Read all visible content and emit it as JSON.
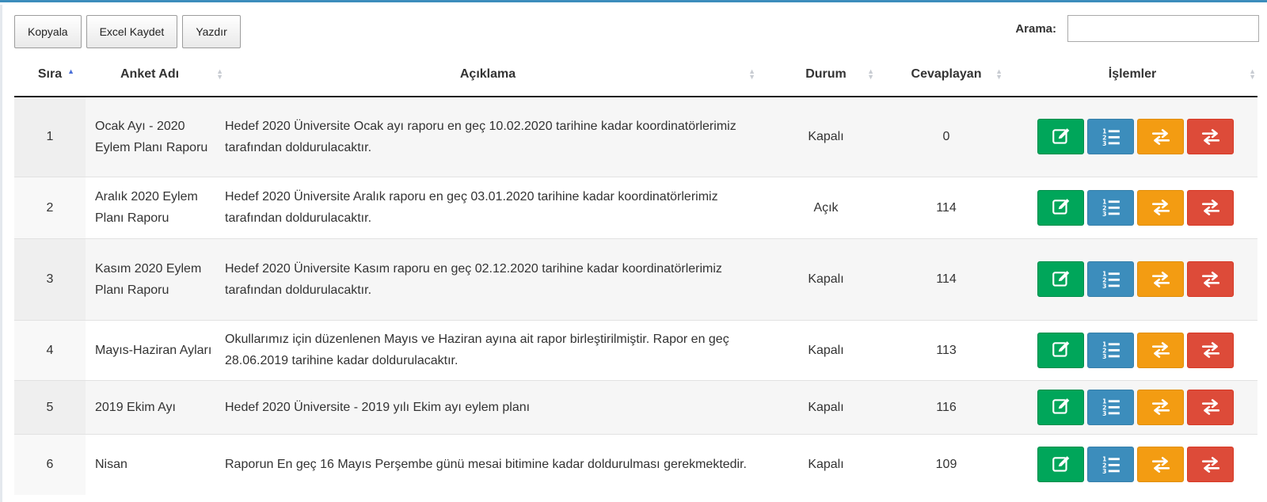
{
  "toolbar": {
    "copy_label": "Kopyala",
    "excel_label": "Excel Kaydet",
    "print_label": "Yazdır"
  },
  "search": {
    "label": "Arama:",
    "value": ""
  },
  "table": {
    "headers": {
      "no": "Sıra",
      "name": "Anket Adı",
      "description": "Açıklama",
      "status": "Durum",
      "respondents": "Cevaplayan",
      "actions": "İşlemler"
    },
    "sorted_column": "no",
    "sort_direction": "asc",
    "rows": [
      {
        "no": "1",
        "name": "Ocak Ayı - 2020 Eylem Planı Raporu",
        "description": "Hedef 2020 Üniversite Ocak ayı raporu en geç 10.02.2020 tarihine kadar koordinatörlerimiz tarafından doldurulacaktır.",
        "status": "Kapalı",
        "respondents": "0"
      },
      {
        "no": "2",
        "name": "Aralık 2020 Eylem Planı Raporu",
        "description": "Hedef 2020 Üniversite Aralık raporu en geç 03.01.2020 tarihine kadar koordinatörlerimiz tarafından doldurulacaktır.",
        "status": "Açık",
        "respondents": "114"
      },
      {
        "no": "3",
        "name": "Kasım 2020 Eylem Planı Raporu",
        "description": "Hedef 2020 Üniversite Kasım raporu en geç 02.12.2020 tarihine kadar koordinatörlerimiz tarafından doldurulacaktır.",
        "status": "Kapalı",
        "respondents": "114"
      },
      {
        "no": "4",
        "name": "Mayıs-Haziran Ayları",
        "description": "Okullarımız için düzenlenen Mayıs ve Haziran ayına ait rapor birleştirilmiştir. Rapor en geç 28.06.2019 tarihine kadar doldurulacaktır.",
        "status": "Kapalı",
        "respondents": "113"
      },
      {
        "no": "5",
        "name": "2019 Ekim Ayı",
        "description": "Hedef 2020 Üniversite - 2019 yılı Ekim ayı eylem planı",
        "status": "Kapalı",
        "respondents": "116"
      },
      {
        "no": "6",
        "name": "Nisan",
        "description": "Raporun En geç 16 Mayıs Perşembe günü mesai bitimine kadar doldurulması gerekmektedir.",
        "status": "Kapalı",
        "respondents": "109"
      }
    ]
  },
  "action_icons": [
    "edit-icon",
    "numbered-list-icon",
    "transfer-arrows-icon",
    "transfer-arrows-icon"
  ],
  "colors": {
    "accent": "#3c8dbc",
    "edit": "#00a65a",
    "list": "#3c8dbc",
    "orange": "#f39c12",
    "red": "#dd4b39"
  }
}
